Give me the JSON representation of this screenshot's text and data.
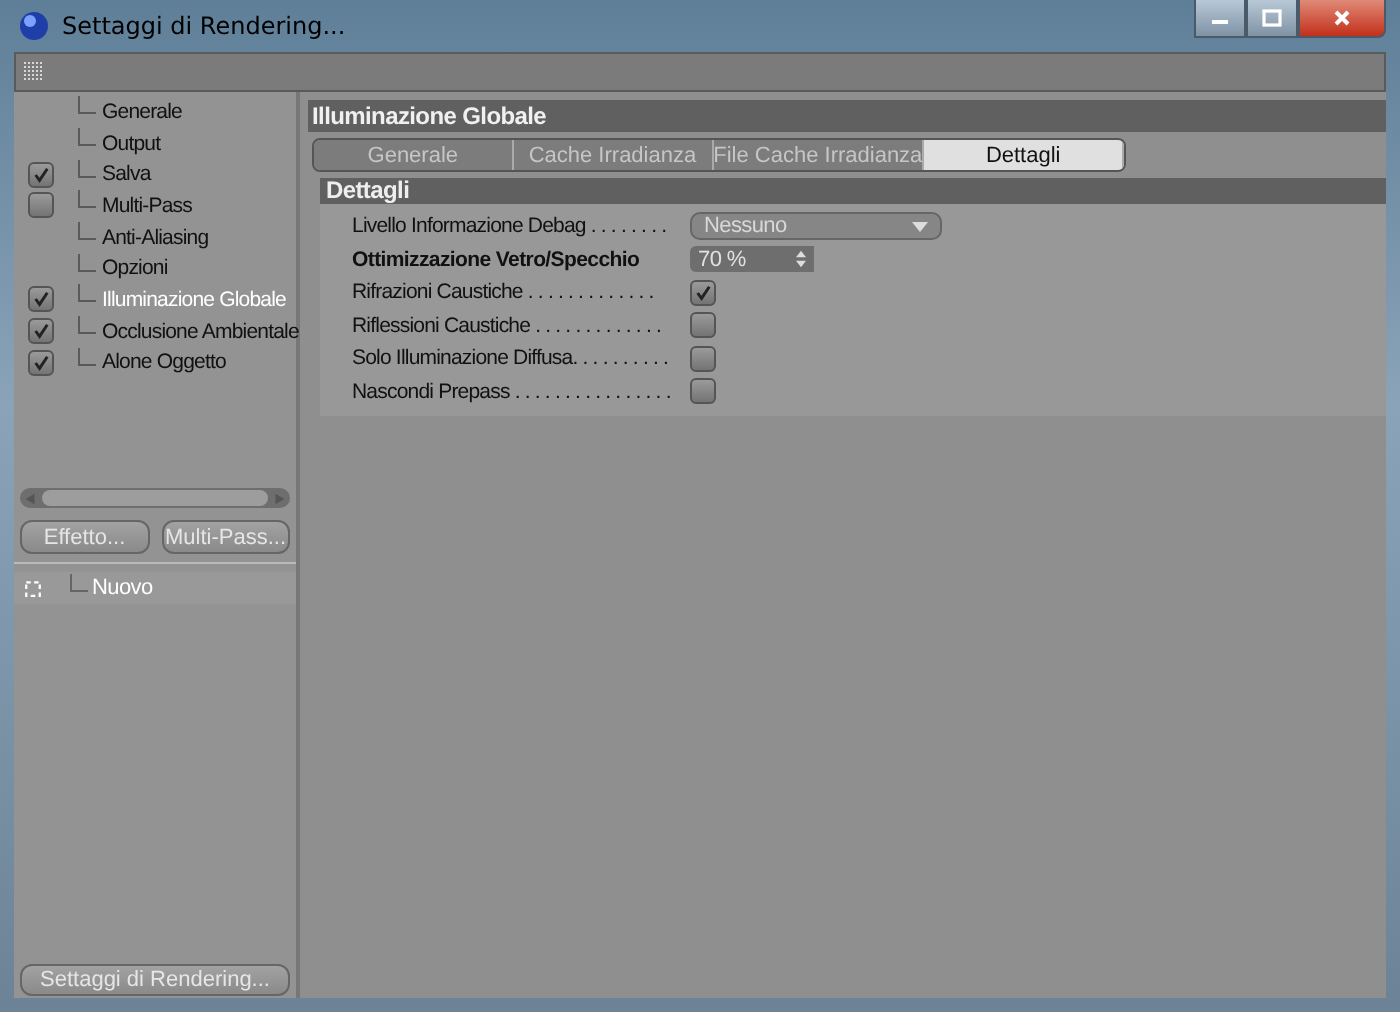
{
  "window": {
    "title": "Settaggi di Rendering..."
  },
  "sidebar": {
    "items": [
      {
        "label": "Generale",
        "kind": "plain",
        "selected": false
      },
      {
        "label": "Output",
        "kind": "plain",
        "selected": false
      },
      {
        "label": "Salva",
        "kind": "check",
        "checked": true,
        "selected": false
      },
      {
        "label": "Multi-Pass",
        "kind": "check",
        "checked": false,
        "selected": false
      },
      {
        "label": "Anti-Aliasing",
        "kind": "plain",
        "selected": false
      },
      {
        "label": "Opzioni",
        "kind": "plain",
        "selected": false
      },
      {
        "label": "Illuminazione Globale",
        "kind": "check",
        "checked": true,
        "selected": true
      },
      {
        "label": "Occlusione Ambientale",
        "kind": "check",
        "checked": true,
        "selected": false
      },
      {
        "label": "Alone Oggetto",
        "kind": "check",
        "checked": true,
        "selected": false
      }
    ],
    "buttons": [
      "Effetto...",
      "Multi-Pass..."
    ],
    "effects": [
      {
        "label": "Nuovo"
      }
    ],
    "footer_button": "Settaggi di Rendering..."
  },
  "panel": {
    "title": "Illuminazione Globale",
    "tabs": [
      {
        "label": "Generale",
        "selected": false
      },
      {
        "label": "Cache Irradianza",
        "selected": false
      },
      {
        "label": "File Cache Irradianza",
        "selected": false
      },
      {
        "label": "Dettagli",
        "selected": true
      }
    ],
    "section": "Dettagli",
    "settings": [
      {
        "kind": "dropdown",
        "label": "Livello Informazione Debag . . . . . . . .",
        "value": "Nessuno"
      },
      {
        "kind": "number",
        "label": "Ottimizzazione  Vetro/Specchio",
        "value": "70 %"
      },
      {
        "kind": "checkbox",
        "label": "Rifrazioni Caustiche . . . . . . . . . . . . .",
        "checked": true
      },
      {
        "kind": "checkbox",
        "label": "Riflessioni Caustiche  . . . . . . . . . . . . .",
        "checked": false
      },
      {
        "kind": "checkbox",
        "label": "Solo Illuminazione Diffusa. . . . . . . . . .",
        "checked": false
      },
      {
        "kind": "checkbox",
        "label": "Nascondi Prepass . . . . . . . . . . . . . . . .",
        "checked": false
      }
    ]
  }
}
